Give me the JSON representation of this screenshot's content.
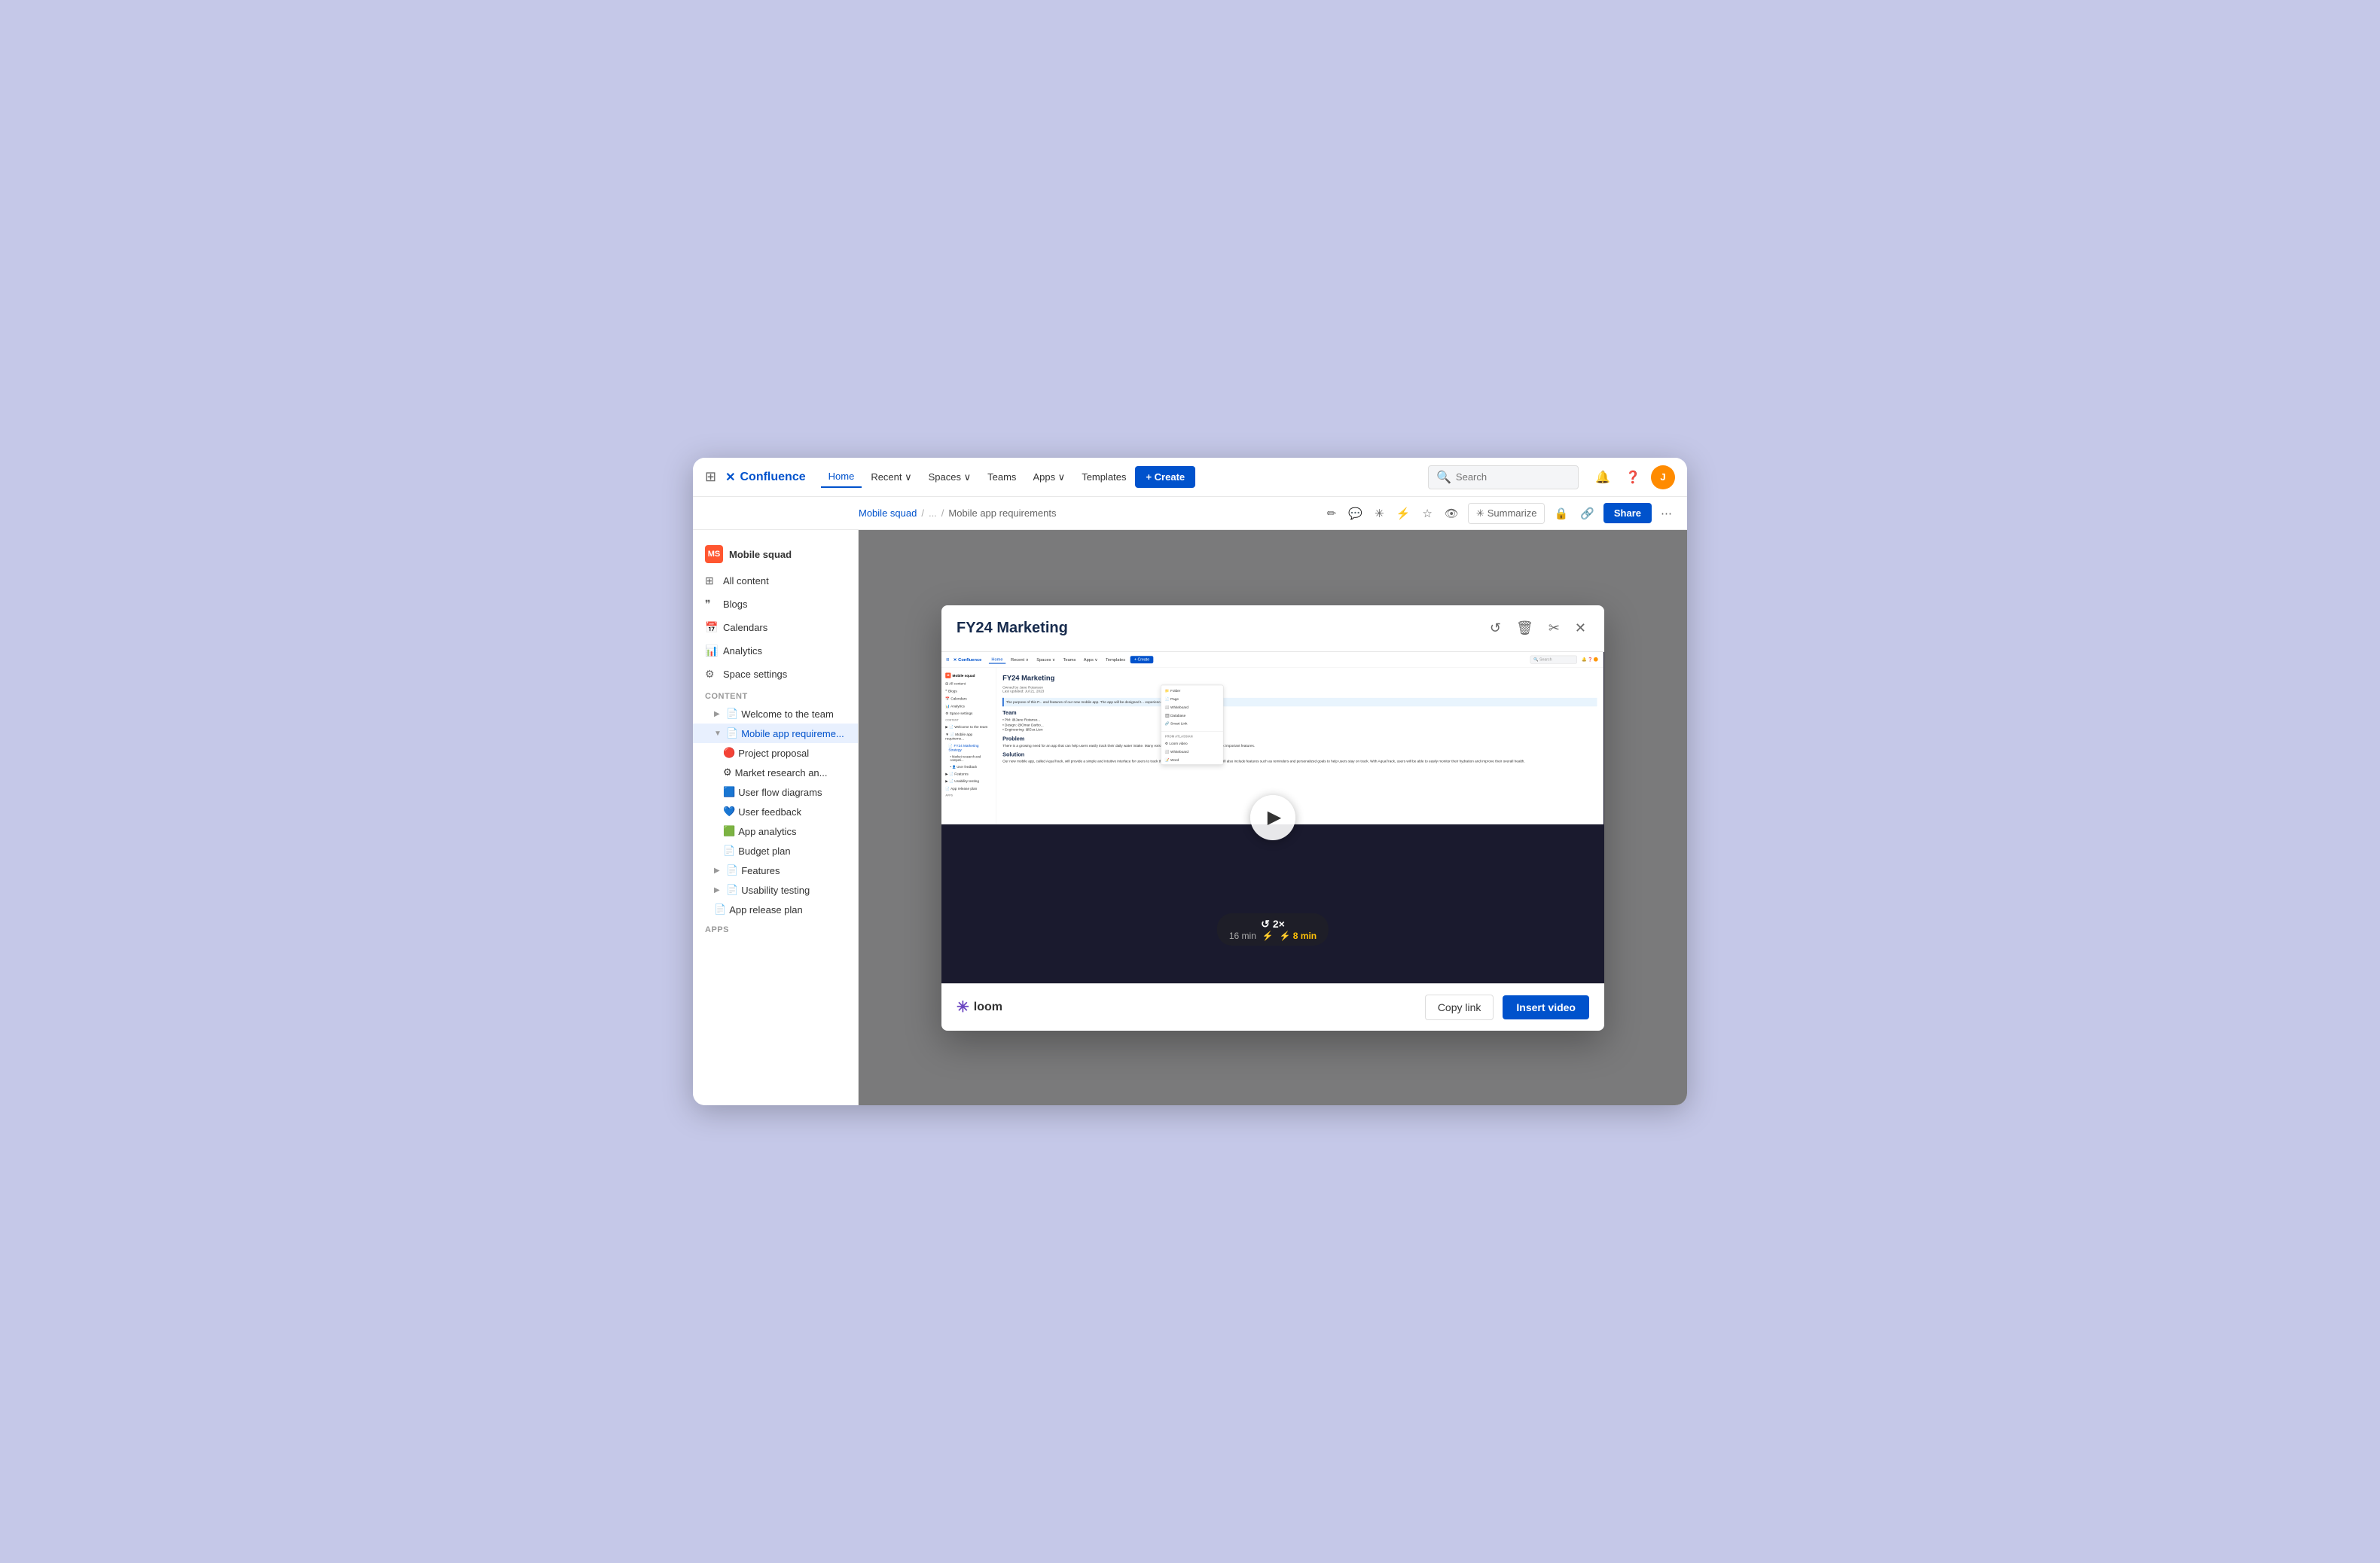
{
  "app": {
    "title": "Confluence"
  },
  "topnav": {
    "logo_text": "Confluence",
    "links": [
      "Home",
      "Recent",
      "Spaces",
      "Teams",
      "Apps",
      "Templates"
    ],
    "active_link": "Home",
    "create_label": "+ Create",
    "search_placeholder": "Search",
    "search_label": "Search"
  },
  "breadcrumb": {
    "space": "Mobile squad",
    "separator": "/",
    "ellipsis": "...",
    "page": "Mobile app requirements",
    "summarize_label": "Summarize",
    "share_label": "Share"
  },
  "sidebar": {
    "space_name": "Mobile squad",
    "space_abbr": "MS",
    "items": [
      {
        "label": "All content",
        "icon": "⊞"
      },
      {
        "label": "Blogs",
        "icon": "❞"
      },
      {
        "label": "Calendars",
        "icon": "📅"
      },
      {
        "label": "Analytics",
        "icon": "📊"
      },
      {
        "label": "Space settings",
        "icon": "⚙"
      }
    ],
    "content_section": "CONTENT",
    "tree": [
      {
        "label": "Welcome to the team",
        "indent": 1,
        "icon": "📄",
        "has_chevron": true
      },
      {
        "label": "Mobile app requirements",
        "indent": 1,
        "icon": "📄",
        "has_chevron": true,
        "active": true
      },
      {
        "label": "Project proposal",
        "indent": 2,
        "icon": "🔴"
      },
      {
        "label": "Market research and...",
        "indent": 2,
        "icon": "⚙"
      },
      {
        "label": "User flow diagrams",
        "indent": 2,
        "icon": "🟦"
      },
      {
        "label": "User feedback",
        "indent": 2,
        "icon": "💙"
      },
      {
        "label": "App analytics",
        "indent": 2,
        "icon": "🟩"
      },
      {
        "label": "Budget plan",
        "indent": 2,
        "icon": "📄"
      },
      {
        "label": "Features",
        "indent": 1,
        "icon": "📄",
        "has_chevron": true
      },
      {
        "label": "Usability testing",
        "indent": 1,
        "icon": "📄",
        "has_chevron": true
      },
      {
        "label": "App release plan",
        "indent": 1,
        "icon": "📄"
      }
    ],
    "apps_section": "APPS"
  },
  "modal": {
    "title": "FY24 Marketing",
    "icons": {
      "undo": "↺",
      "trash": "🗑",
      "scissors": "✂",
      "close": "✕"
    },
    "video": {
      "speed_label": "2×",
      "time_normal": "16 min",
      "time_fast": "8 min"
    },
    "footer": {
      "loom_label": "loom",
      "copy_link_label": "Copy link",
      "insert_video_label": "Insert video"
    }
  },
  "mini_confluence": {
    "nav_links": [
      "Home",
      "Recent ∨",
      "Spaces ∨",
      "Teams",
      "Apps ∨",
      "Templates"
    ],
    "active_link": "Home",
    "create_label": "+ Create",
    "search_placeholder": "Search",
    "sidebar_items": [
      "Mobile squad",
      "All content",
      "Blogs",
      "Calendars",
      "Analytics",
      "Space settings",
      "CONTENT",
      "Welcome to the team",
      "Mobile app requireme...",
      "FY24 Marketing Strategy",
      "Market research and comp...",
      "User feedback",
      "Features",
      "Usability testing",
      "App release plan",
      "APPS"
    ],
    "page_title": "FY24 Marketing",
    "meta_owner": "Owned by Jane Rotanson",
    "meta_updated": "Last updated: Jul 21, 2023",
    "section_team": "Team",
    "team_pm": "PM: @Jane Rotanson",
    "team_design": "Design: @Omar Darbo...",
    "team_engineering": "Engineering: @Eva Lien",
    "section_problem": "Problem",
    "problem_text": "There is a growing need for an app that can help users easily track their daily water intake. Many existing apps are either difficult to use or lack important features.",
    "section_solution": "Solution",
    "solution_text": "Our new mobile app, called AquaTrack, will provide a simple and intuitive interface for users to track their water intake throughout the day. It will also include features such as reminders and personalized goals to help users stay on track. With AquaTrack, users will be able to easily monitor their hydration and improve their overall health.",
    "blue_box_text": "The purpose of this P... and features of our new mobile app. The app will be designed t... experience, for both iOS and Android.",
    "dropdown_items": [
      {
        "label": "Folder",
        "section": "main"
      },
      {
        "label": "Page",
        "section": "main"
      },
      {
        "label": "Whiteboard",
        "section": "main"
      },
      {
        "label": "Database",
        "section": "main"
      },
      {
        "label": "Smart Link",
        "section": "main"
      },
      {
        "label": "Loom video",
        "section": "atlassian"
      },
      {
        "label": "Whiteboard",
        "section": "atlassian"
      },
      {
        "label": "Word",
        "section": "atlassian"
      }
    ],
    "dropdown_section_label": "FROM ATLASSIAN"
  }
}
